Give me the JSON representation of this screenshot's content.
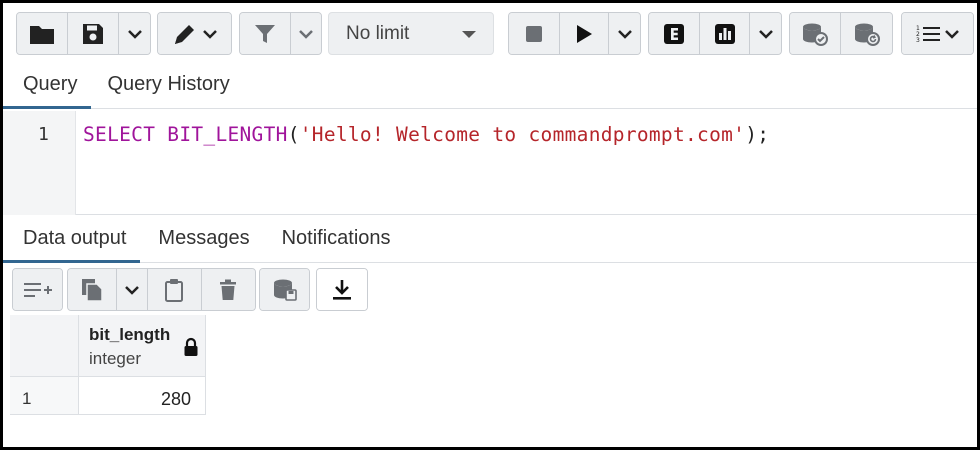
{
  "toolbar": {
    "limit_value": "No limit",
    "icons": [
      "folder-icon",
      "save-icon",
      "chevron-down-icon",
      "pen-icon",
      "chevron-down-icon",
      "filter-icon",
      "chevron-down-icon",
      "stop-icon",
      "play-icon",
      "chevron-down-icon",
      "explain-icon",
      "explain-analyze-icon",
      "chevron-down-icon",
      "commit-icon",
      "rollback-icon",
      "macros-icon"
    ]
  },
  "query_tabs": [
    {
      "label": "Query",
      "active": true
    },
    {
      "label": "Query History",
      "active": false
    }
  ],
  "editor": {
    "line_number": "1",
    "keyword": "SELECT BIT_LENGTH",
    "open_paren": "(",
    "string_literal": "'Hello! Welcome to commandprompt.com'",
    "close": ");"
  },
  "output_tabs": [
    {
      "label": "Data output",
      "active": true
    },
    {
      "label": "Messages",
      "active": false
    },
    {
      "label": "Notifications",
      "active": false
    }
  ],
  "result": {
    "columns": [
      {
        "name": "bit_length",
        "type": "integer",
        "locked": true
      }
    ],
    "rows": [
      {
        "row_number": "1",
        "values": [
          "280"
        ]
      }
    ]
  },
  "colors": {
    "accent": "#326690",
    "keyword": "#a0149b",
    "string": "#b5252a",
    "toolbar_bg": "#eef0f2"
  }
}
